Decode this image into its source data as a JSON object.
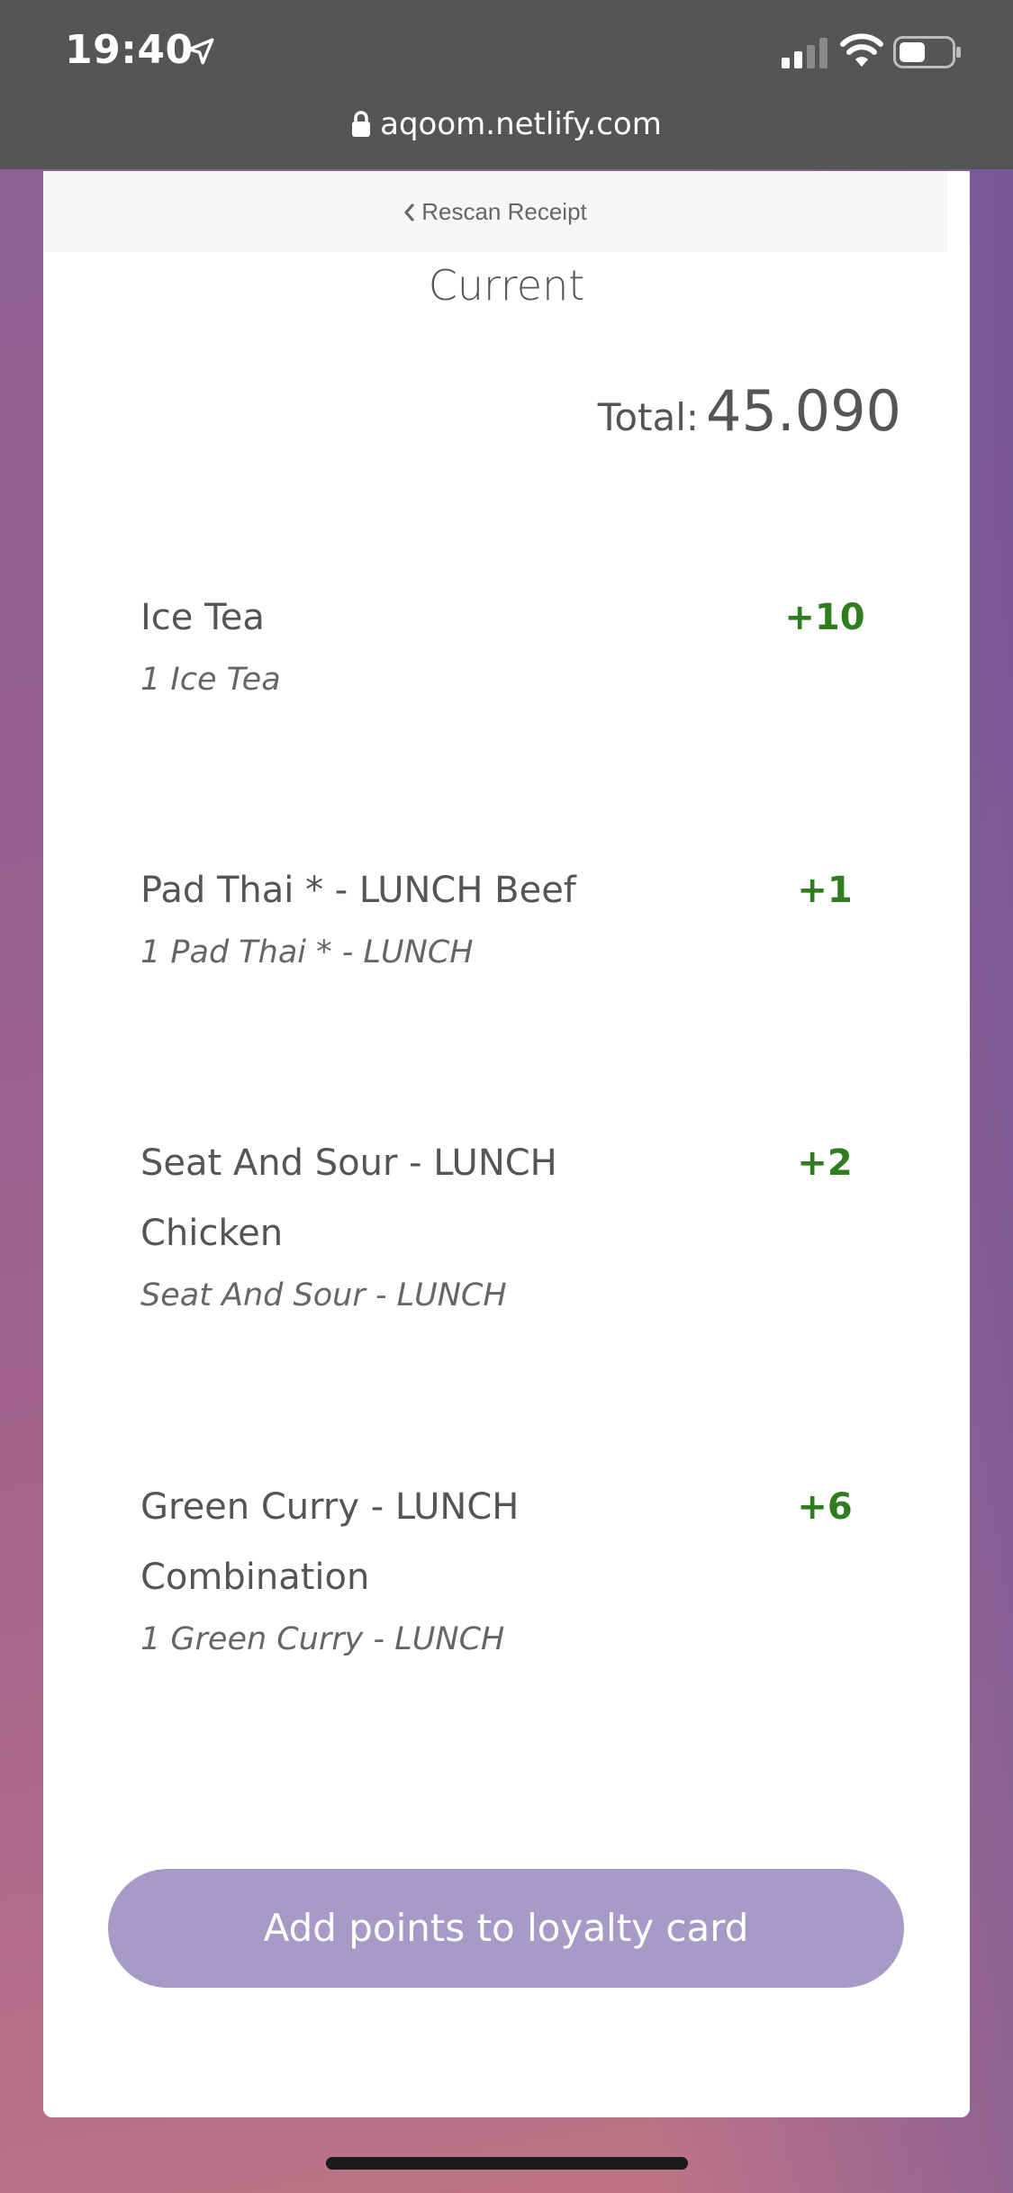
{
  "status_bar": {
    "time": "19:40"
  },
  "browser": {
    "url": "aqoom.netlify.com"
  },
  "nav": {
    "rescan_label": "Rescan Receipt"
  },
  "page": {
    "title": "Current",
    "total_label": "Total:",
    "total_value": "45.090"
  },
  "items": [
    {
      "name": "Ice Tea",
      "sub": "1 Ice Tea",
      "points": "+10"
    },
    {
      "name": "Pad Thai * - LUNCH Beef",
      "sub": "1 Pad Thai * - LUNCH",
      "points": "+1"
    },
    {
      "name": "Seat And Sour - LUNCH Chicken",
      "sub": "Seat And Sour - LUNCH",
      "points": "+2"
    },
    {
      "name": "Green Curry - LUNCH Combination",
      "sub": "1 Green Curry - LUNCH",
      "points": "+6"
    }
  ],
  "cta": {
    "label": "Add points to loyalty card"
  },
  "colors": {
    "points_green": "#2f7d1e",
    "cta_purple": "#a59bc6",
    "browser_bar": "#555555"
  }
}
